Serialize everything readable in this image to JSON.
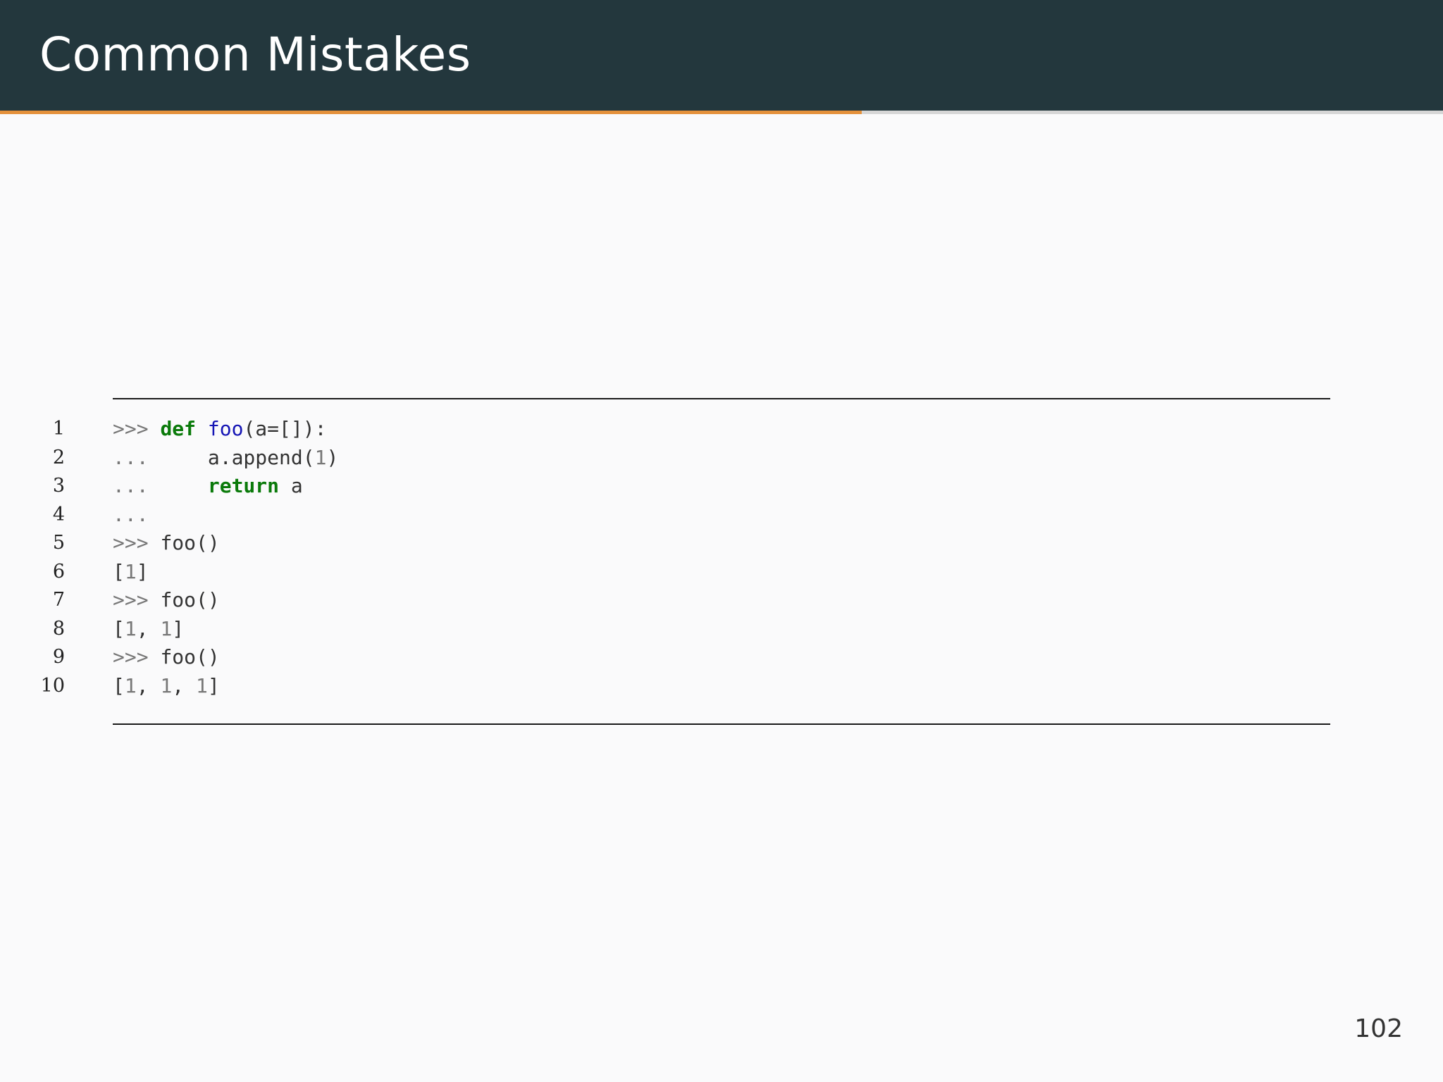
{
  "slide": {
    "title": "Common Mistakes",
    "page_number": "102",
    "progress_fraction": 0.597
  },
  "colors": {
    "header_bg": "#23373d",
    "progress_accent": "#e4913b",
    "keyword": "#0a7a0a",
    "function_name": "#1515b5",
    "prompt": "#777777",
    "background": "#fafafb"
  },
  "code": {
    "lines": [
      {
        "number": "1",
        "tokens": [
          {
            "type": "prompt",
            "text": ">>> "
          },
          {
            "type": "kw",
            "text": "def"
          },
          {
            "type": "plain",
            "text": " "
          },
          {
            "type": "fn",
            "text": "foo"
          },
          {
            "type": "plain",
            "text": "(a=[]):"
          }
        ]
      },
      {
        "number": "2",
        "tokens": [
          {
            "type": "prompt",
            "text": "...     "
          },
          {
            "type": "plain",
            "text": "a.append("
          },
          {
            "type": "num",
            "text": "1"
          },
          {
            "type": "plain",
            "text": ")"
          }
        ]
      },
      {
        "number": "3",
        "tokens": [
          {
            "type": "prompt",
            "text": "...     "
          },
          {
            "type": "kw",
            "text": "return"
          },
          {
            "type": "plain",
            "text": " a"
          }
        ]
      },
      {
        "number": "4",
        "tokens": [
          {
            "type": "prompt",
            "text": "..."
          }
        ]
      },
      {
        "number": "5",
        "tokens": [
          {
            "type": "prompt",
            "text": ">>> "
          },
          {
            "type": "plain",
            "text": "foo()"
          }
        ]
      },
      {
        "number": "6",
        "tokens": [
          {
            "type": "plain",
            "text": "["
          },
          {
            "type": "num",
            "text": "1"
          },
          {
            "type": "plain",
            "text": "]"
          }
        ]
      },
      {
        "number": "7",
        "tokens": [
          {
            "type": "prompt",
            "text": ">>> "
          },
          {
            "type": "plain",
            "text": "foo()"
          }
        ]
      },
      {
        "number": "8",
        "tokens": [
          {
            "type": "plain",
            "text": "["
          },
          {
            "type": "num",
            "text": "1"
          },
          {
            "type": "plain",
            "text": ", "
          },
          {
            "type": "num",
            "text": "1"
          },
          {
            "type": "plain",
            "text": "]"
          }
        ]
      },
      {
        "number": "9",
        "tokens": [
          {
            "type": "prompt",
            "text": ">>> "
          },
          {
            "type": "plain",
            "text": "foo()"
          }
        ]
      },
      {
        "number": "10",
        "tokens": [
          {
            "type": "plain",
            "text": "["
          },
          {
            "type": "num",
            "text": "1"
          },
          {
            "type": "plain",
            "text": ", "
          },
          {
            "type": "num",
            "text": "1"
          },
          {
            "type": "plain",
            "text": ", "
          },
          {
            "type": "num",
            "text": "1"
          },
          {
            "type": "plain",
            "text": "]"
          }
        ]
      }
    ]
  }
}
